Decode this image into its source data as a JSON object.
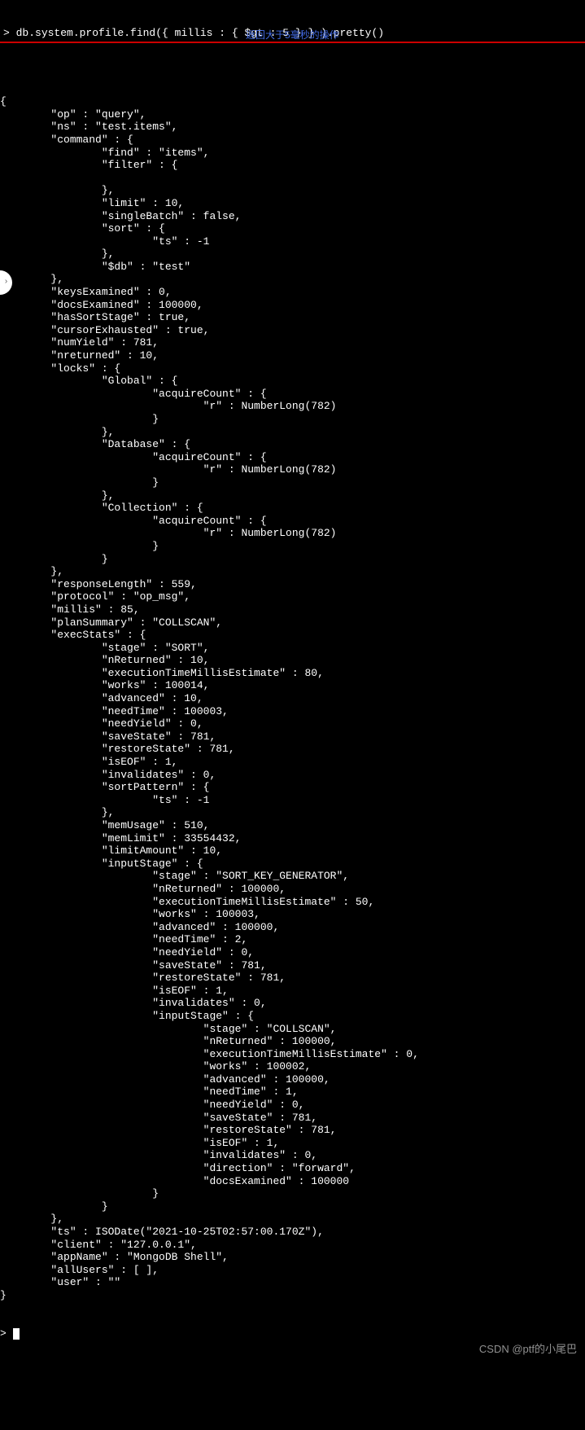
{
  "prompt_prefix": "> ",
  "command": "db.system.profile.find({ millis : { $gt : 5 } } ).pretty()",
  "annotation": "返回大于5毫秒的操作",
  "watermark": "CSDN @ptf的小尾巴",
  "end_prompt": "> ",
  "output_lines": [
    "{",
    "        \"op\" : \"query\",",
    "        \"ns\" : \"test.items\",",
    "        \"command\" : {",
    "                \"find\" : \"items\",",
    "                \"filter\" : {",
    "",
    "                },",
    "                \"limit\" : 10,",
    "                \"singleBatch\" : false,",
    "                \"sort\" : {",
    "                        \"ts\" : -1",
    "                },",
    "                \"$db\" : \"test\"",
    "        },",
    "        \"keysExamined\" : 0,",
    "        \"docsExamined\" : 100000,",
    "        \"hasSortStage\" : true,",
    "        \"cursorExhausted\" : true,",
    "        \"numYield\" : 781,",
    "        \"nreturned\" : 10,",
    "        \"locks\" : {",
    "                \"Global\" : {",
    "                        \"acquireCount\" : {",
    "                                \"r\" : NumberLong(782)",
    "                        }",
    "                },",
    "                \"Database\" : {",
    "                        \"acquireCount\" : {",
    "                                \"r\" : NumberLong(782)",
    "                        }",
    "                },",
    "                \"Collection\" : {",
    "                        \"acquireCount\" : {",
    "                                \"r\" : NumberLong(782)",
    "                        }",
    "                }",
    "        },",
    "        \"responseLength\" : 559,",
    "        \"protocol\" : \"op_msg\",",
    "        \"millis\" : 85,",
    "        \"planSummary\" : \"COLLSCAN\",",
    "        \"execStats\" : {",
    "                \"stage\" : \"SORT\",",
    "                \"nReturned\" : 10,",
    "                \"executionTimeMillisEstimate\" : 80,",
    "                \"works\" : 100014,",
    "                \"advanced\" : 10,",
    "                \"needTime\" : 100003,",
    "                \"needYield\" : 0,",
    "                \"saveState\" : 781,",
    "                \"restoreState\" : 781,",
    "                \"isEOF\" : 1,",
    "                \"invalidates\" : 0,",
    "                \"sortPattern\" : {",
    "                        \"ts\" : -1",
    "                },",
    "                \"memUsage\" : 510,",
    "                \"memLimit\" : 33554432,",
    "                \"limitAmount\" : 10,",
    "                \"inputStage\" : {",
    "                        \"stage\" : \"SORT_KEY_GENERATOR\",",
    "                        \"nReturned\" : 100000,",
    "                        \"executionTimeMillisEstimate\" : 50,",
    "                        \"works\" : 100003,",
    "                        \"advanced\" : 100000,",
    "                        \"needTime\" : 2,",
    "                        \"needYield\" : 0,",
    "                        \"saveState\" : 781,",
    "                        \"restoreState\" : 781,",
    "                        \"isEOF\" : 1,",
    "                        \"invalidates\" : 0,",
    "                        \"inputStage\" : {",
    "                                \"stage\" : \"COLLSCAN\",",
    "                                \"nReturned\" : 100000,",
    "                                \"executionTimeMillisEstimate\" : 0,",
    "                                \"works\" : 100002,",
    "                                \"advanced\" : 100000,",
    "                                \"needTime\" : 1,",
    "                                \"needYield\" : 0,",
    "                                \"saveState\" : 781,",
    "                                \"restoreState\" : 781,",
    "                                \"isEOF\" : 1,",
    "                                \"invalidates\" : 0,",
    "                                \"direction\" : \"forward\",",
    "                                \"docsExamined\" : 100000",
    "                        }",
    "                }",
    "        },",
    "        \"ts\" : ISODate(\"2021-10-25T02:57:00.170Z\"),",
    "        \"client\" : \"127.0.0.1\",",
    "        \"appName\" : \"MongoDB Shell\",",
    "        \"allUsers\" : [ ],",
    "        \"user\" : \"\"",
    "}"
  ]
}
